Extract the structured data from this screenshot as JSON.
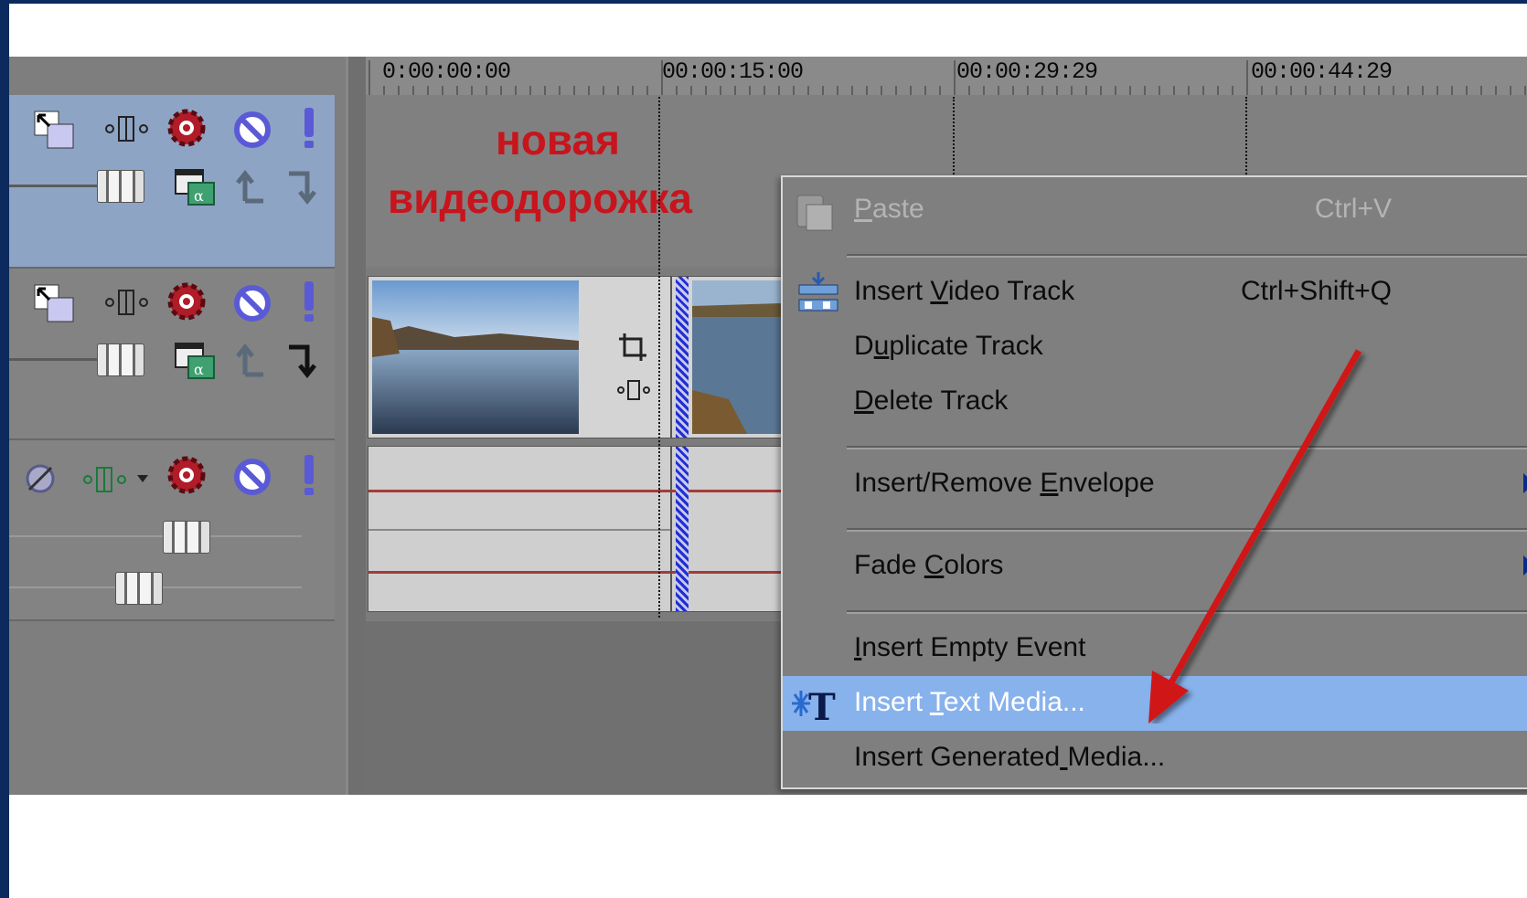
{
  "timeline": {
    "ticks": [
      "0:00:00:00",
      "00:00:15:00",
      "00:00:29:29",
      "00:00:44:29"
    ]
  },
  "annotation": {
    "line1": "новая",
    "line2": "видеодорожка",
    "color": "#c8141c"
  },
  "context_menu": {
    "items": [
      {
        "label": "Paste",
        "mnemonic_index": 0,
        "shortcut": "Ctrl+V",
        "disabled": true
      },
      {
        "label": "Insert Video Track",
        "mnemonic_index": 7,
        "shortcut": "Ctrl+Shift+Q"
      },
      {
        "label": "Duplicate Track",
        "mnemonic_index": 1,
        "shortcut": ""
      },
      {
        "label": "Delete Track",
        "mnemonic_index": 0,
        "shortcut": ""
      },
      {
        "label": "Insert/Remove Envelope",
        "mnemonic_index": 14,
        "shortcut": "",
        "submenu": true
      },
      {
        "label": "Fade Colors",
        "mnemonic_index": 5,
        "shortcut": "",
        "submenu": true
      },
      {
        "label": "Insert Empty Event",
        "mnemonic_index": 0,
        "shortcut": ""
      },
      {
        "label": "Insert Text Media...",
        "mnemonic_index": 7,
        "shortcut": "",
        "highlighted": true
      },
      {
        "label": "Insert Generated Media...",
        "mnemonic_index": 16,
        "shortcut": ""
      }
    ]
  },
  "icons": {
    "compositing": "compositing-icon",
    "pan": "pan-crop-icon",
    "fx": "track-fx-icon",
    "mute": "mute-icon",
    "solo": "solo-icon",
    "motion": "track-motion-icon",
    "parent_up": "make-compositing-parent-icon",
    "child_down": "make-compositing-child-icon"
  },
  "colors": {
    "highlight": "#88b2ec",
    "selected_track": "#8ea4c4",
    "arrow": "#d01818"
  }
}
